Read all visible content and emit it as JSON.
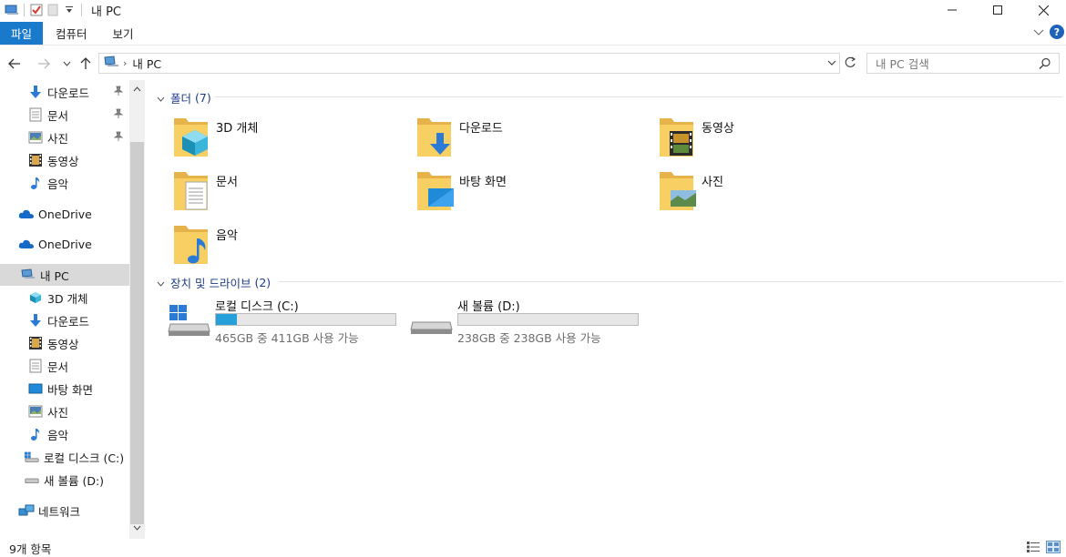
{
  "window": {
    "title": "내 PC"
  },
  "ribbon": {
    "tabs": [
      "파일",
      "컴퓨터",
      "보기"
    ]
  },
  "address": {
    "path": "내 PC",
    "search_placeholder": "내 PC 검색"
  },
  "nav": {
    "items": [
      {
        "label": "다운로드",
        "icon": "download-arrow-icon",
        "pinned": true
      },
      {
        "label": "문서",
        "icon": "document-icon",
        "pinned": true
      },
      {
        "label": "사진",
        "icon": "pictures-icon",
        "pinned": true
      },
      {
        "label": "동영상",
        "icon": "video-icon",
        "pinned": false
      },
      {
        "label": "음악",
        "icon": "music-note-icon",
        "pinned": false
      },
      {
        "label": "OneDrive",
        "icon": "onedrive-cloud-icon",
        "pinned": false
      },
      {
        "label": "OneDrive",
        "icon": "onedrive-cloud-icon",
        "pinned": false
      },
      {
        "label": "내 PC",
        "icon": "this-pc-icon",
        "pinned": false,
        "selected": true
      },
      {
        "label": "3D 개체",
        "icon": "3d-objects-icon",
        "pinned": false
      },
      {
        "label": "다운로드",
        "icon": "download-arrow-icon",
        "pinned": false
      },
      {
        "label": "동영상",
        "icon": "video-icon",
        "pinned": false
      },
      {
        "label": "문서",
        "icon": "document-icon",
        "pinned": false
      },
      {
        "label": "바탕 화면",
        "icon": "desktop-icon",
        "pinned": false
      },
      {
        "label": "사진",
        "icon": "pictures-icon",
        "pinned": false
      },
      {
        "label": "음악",
        "icon": "music-note-icon",
        "pinned": false
      },
      {
        "label": "로컬 디스크 (C:)",
        "icon": "windows-drive-icon",
        "pinned": false
      },
      {
        "label": "새 볼륨 (D:)",
        "icon": "drive-icon",
        "pinned": false
      },
      {
        "label": "네트워크",
        "icon": "network-icon",
        "pinned": false
      }
    ]
  },
  "folders_group": {
    "title": "폴더",
    "count": "(7)",
    "items": [
      {
        "label": "3D 개체",
        "icon": "3d-objects-folder-icon"
      },
      {
        "label": "다운로드",
        "icon": "downloads-folder-icon"
      },
      {
        "label": "동영상",
        "icon": "videos-folder-icon"
      },
      {
        "label": "문서",
        "icon": "documents-folder-icon"
      },
      {
        "label": "바탕 화면",
        "icon": "desktop-folder-icon"
      },
      {
        "label": "사진",
        "icon": "pictures-folder-icon"
      },
      {
        "label": "음악",
        "icon": "music-folder-icon"
      }
    ]
  },
  "drives_group": {
    "title": "장치 및 드라이브",
    "count": "(2)",
    "items": [
      {
        "label": "로컬 디스크 (C:)",
        "info": "465GB 중 411GB 사용 가능",
        "used_fraction": 0.116,
        "icon": "windows-drive-icon"
      },
      {
        "label": "새 볼륨 (D:)",
        "info": "238GB 중 238GB 사용 가능",
        "used_fraction": 0.0,
        "icon": "drive-icon"
      }
    ]
  },
  "status": {
    "item_count": "9개 항목"
  },
  "colors": {
    "accent": "#1979ca",
    "drive_bar": "#26a0da",
    "group_header": "#1e3a8a"
  }
}
